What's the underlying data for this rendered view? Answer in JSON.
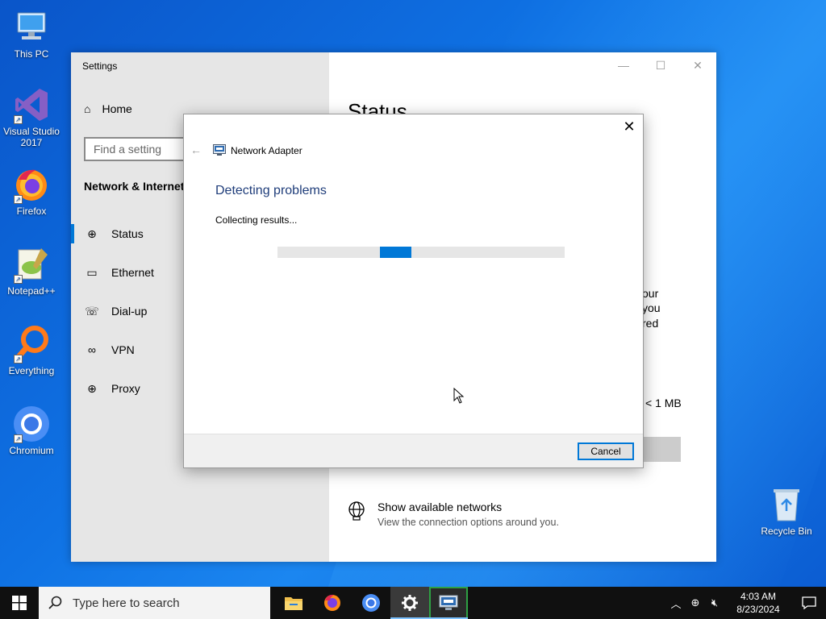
{
  "desktop": {
    "icons": [
      {
        "label": "This PC",
        "icon": "computer-icon"
      },
      {
        "label": "Visual Studio 2017",
        "icon": "visual-studio-icon"
      },
      {
        "label": "Firefox",
        "icon": "firefox-icon"
      },
      {
        "label": "Notepad++",
        "icon": "notepadpp-icon"
      },
      {
        "label": "Everything",
        "icon": "everything-search-icon"
      },
      {
        "label": "Chromium",
        "icon": "chromium-icon"
      },
      {
        "label": "Recycle Bin",
        "icon": "recycle-bin-icon"
      }
    ]
  },
  "settings": {
    "window_title": "Settings",
    "home_label": "Home",
    "search_placeholder": "Find a setting",
    "section_title": "Network & Internet",
    "nav_items": [
      {
        "label": "Status",
        "icon": "status-globe-icon",
        "active": true
      },
      {
        "label": "Ethernet",
        "icon": "ethernet-icon",
        "active": false
      },
      {
        "label": "Dial-up",
        "icon": "dialup-icon",
        "active": false
      },
      {
        "label": "VPN",
        "icon": "vpn-icon",
        "active": false
      },
      {
        "label": "Proxy",
        "icon": "proxy-globe-icon",
        "active": false
      }
    ],
    "content_title": "Status",
    "partial_text_lines": [
      "our",
      "you",
      "red"
    ],
    "partial_size": "< 1 MB",
    "show_networks": {
      "title": "Show available networks",
      "subtitle": "View the connection options around you."
    }
  },
  "dialog": {
    "app_title": "Network Adapter",
    "heading": "Detecting problems",
    "status_text": "Collecting results...",
    "cancel_label": "Cancel",
    "progress_style": "indeterminate"
  },
  "taskbar": {
    "search_placeholder": "Type here to search",
    "apps": [
      "file-explorer-icon",
      "firefox-icon",
      "chromium-icon",
      "settings-gear-icon",
      "network-troubleshooter-icon"
    ],
    "time": "4:03 AM",
    "date": "8/23/2024"
  },
  "colors": {
    "accent": "#0078d7",
    "dialog_heading": "#1f3d7a",
    "taskbar": "#101010"
  }
}
